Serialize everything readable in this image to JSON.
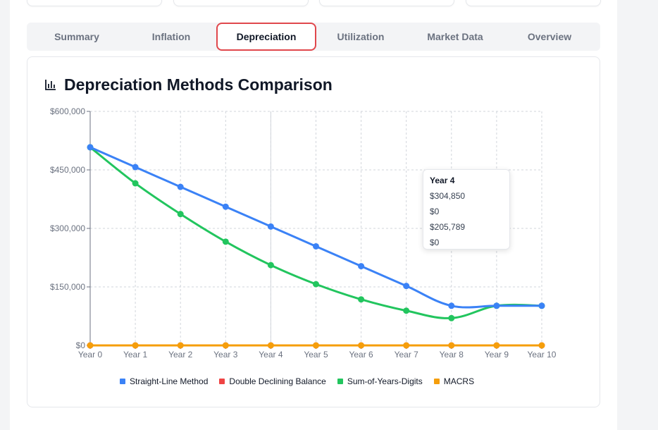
{
  "tabs": [
    {
      "label": "Summary",
      "active": false
    },
    {
      "label": "Inflation",
      "active": false
    },
    {
      "label": "Depreciation",
      "active": true
    },
    {
      "label": "Utilization",
      "active": false
    },
    {
      "label": "Market Data",
      "active": false
    },
    {
      "label": "Overview",
      "active": false
    }
  ],
  "chart_title": "Depreciation Methods Comparison",
  "tooltip": {
    "title": "Year 4",
    "values": [
      "$304,850",
      "$0",
      "$205,789",
      "$0"
    ]
  },
  "chart_data": {
    "type": "line",
    "title": "Depreciation Methods Comparison",
    "categories": [
      "Year 0",
      "Year 1",
      "Year 2",
      "Year 3",
      "Year 4",
      "Year 5",
      "Year 6",
      "Year 7",
      "Year 8",
      "Year 9",
      "Year 10"
    ],
    "y_ticks": [
      0,
      150000,
      300000,
      450000,
      600000
    ],
    "y_tick_labels": [
      "$0",
      "$150,000",
      "$300,000",
      "$450,000",
      "$600,000"
    ],
    "ylim": [
      0,
      600000
    ],
    "grid": true,
    "legend_position": "bottom",
    "series": [
      {
        "name": "Straight-Line Method",
        "color": "#3b82f6",
        "values": [
          508000,
          457200,
          406400,
          355600,
          304850,
          254000,
          203200,
          152400,
          101600,
          101600,
          101600
        ]
      },
      {
        "name": "Double Declining Balance",
        "color": "#ef4444",
        "values": [
          0,
          0,
          0,
          0,
          0,
          0,
          0,
          0,
          0,
          0,
          0
        ]
      },
      {
        "name": "Sum-of-Years-Digits",
        "color": "#22c55e",
        "values": [
          508000,
          415600,
          336800,
          266000,
          205789,
          157000,
          118000,
          89000,
          70000,
          101600,
          101600
        ]
      },
      {
        "name": "MACRS",
        "color": "#f59e0b",
        "values": [
          0,
          0,
          0,
          0,
          0,
          0,
          0,
          0,
          0,
          0,
          0
        ]
      }
    ]
  }
}
